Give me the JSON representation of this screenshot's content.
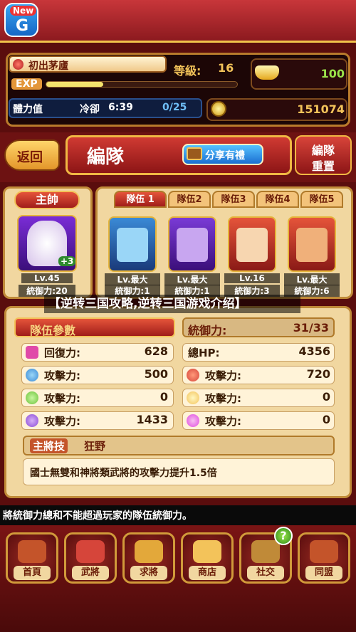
{
  "app": {
    "new_badge_label": "New",
    "new_badge_glyph": "G"
  },
  "status": {
    "player_name": "初出茅廬",
    "exp_label": "EXP",
    "exp_progress": 0.3,
    "level_label": "等級:",
    "level_value": "16",
    "ingot_value": "100",
    "stamina_label": "體力值",
    "cooldown_label": "冷卻",
    "cooldown_time": "6:39",
    "stamina_value": "0/25",
    "coin_value": "151074"
  },
  "header": {
    "back_label": "返回",
    "title": "編隊",
    "share_label": "分享有禮",
    "reset_label_line1": "編隊",
    "reset_label_line2": "重置"
  },
  "leader": {
    "header": "主帥",
    "badge": "+3",
    "level": "Lv.45",
    "command": "統御力:20"
  },
  "tabs": [
    "隊伍 1",
    "隊伍2",
    "隊伍3",
    "隊伍4",
    "隊伍5"
  ],
  "members": [
    {
      "level": "Lv.最大",
      "command": "統御力:1",
      "color": "#3a8ad6"
    },
    {
      "level": "Lv.最大",
      "command": "統御力:1",
      "color": "#7a3ad6"
    },
    {
      "level": "Lv.16",
      "command": "統御力:3",
      "color": "#d6453a"
    },
    {
      "level": "Lv.最大",
      "command": "統御力:6",
      "color": "#d6453a"
    }
  ],
  "overlay_title": "【逆转三国攻略,逆转三国游戏介绍】",
  "stats": {
    "params_title": "隊伍參數",
    "command_label": "統御力:",
    "command_value": "31/33",
    "rows": [
      {
        "label": "回復力:",
        "value": "628",
        "color": "#e04aa8"
      },
      {
        "label": "總HP:",
        "value": "4356",
        "color": "#d6453a"
      },
      {
        "label": "攻擊力:",
        "value": "500",
        "color": "#3a8ad6"
      },
      {
        "label": "攻擊力:",
        "value": "720",
        "color": "#d6453a"
      },
      {
        "label": "攻擊力:",
        "value": "0",
        "color": "#6ac23a"
      },
      {
        "label": "攻擊力:",
        "value": "0",
        "color": "#f3c35a"
      },
      {
        "label": "攻擊力:",
        "value": "1433",
        "color": "#8a4ad6"
      },
      {
        "label": "攻擊力:",
        "value": "0",
        "color": "#e04ae0"
      }
    ],
    "skill_label": "主將技",
    "skill_name": "狂野",
    "skill_desc": "國士無雙和神將類武將的攻擊力提升1.5倍"
  },
  "info_text": "將統御力總和不能超過玩家的隊伍統御力。",
  "nav": [
    {
      "label": "首頁",
      "color": "#c4542a"
    },
    {
      "label": "武將",
      "color": "#d6453a"
    },
    {
      "label": "求將",
      "color": "#e3a83a"
    },
    {
      "label": "商店",
      "color": "#f3c35a"
    },
    {
      "label": "社交",
      "color": "#c08a38"
    },
    {
      "label": "同盟",
      "color": "#c4542a"
    }
  ],
  "help_badge": "?"
}
